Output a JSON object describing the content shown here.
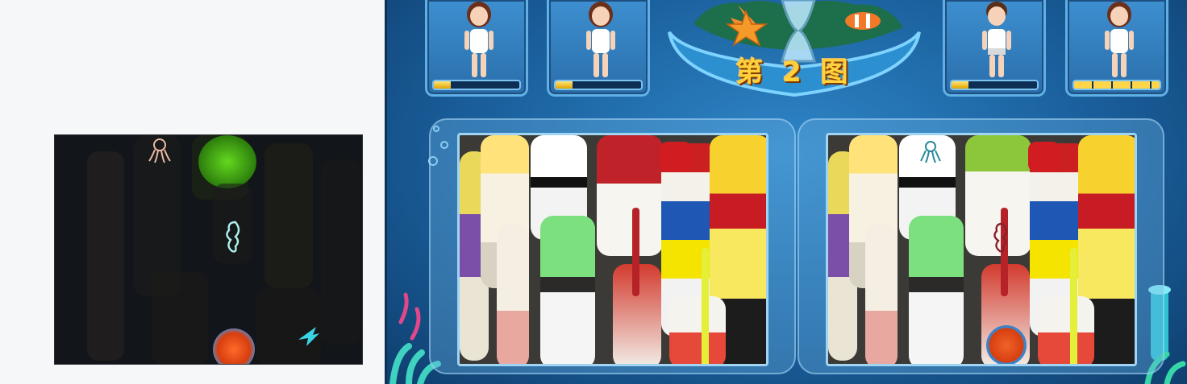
{
  "game": {
    "level_label": "第 2 图",
    "colors": {
      "water": "#1a5f9c",
      "progress": "#ffd54a",
      "frame": "#9fd4f3"
    }
  },
  "players": [
    {
      "avatar": "girl-avatar",
      "progress": 0.2
    },
    {
      "avatar": "girl-avatar",
      "progress": 0.2
    },
    {
      "avatar": "boy-avatar",
      "progress": 0.2
    },
    {
      "avatar": "girl-avatar",
      "progress": 1.0
    }
  ],
  "photos": {
    "left_name": "original-photo",
    "right_name": "modified-photo",
    "subject": "lobster-buoys"
  },
  "preview": {
    "icons": [
      "octopus-icon",
      "seahorse-icon",
      "fish-icon"
    ]
  }
}
